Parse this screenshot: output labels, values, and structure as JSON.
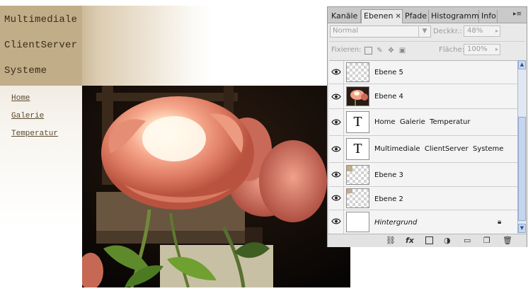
{
  "site": {
    "title_lines": [
      "Multimediale",
      "ClientServer",
      "Systeme"
    ],
    "nav": [
      "Home",
      "Galerie",
      "Temperatur"
    ]
  },
  "panel": {
    "tabs": [
      "Kanäle",
      "Ebenen",
      "Pfade",
      "Histogramm",
      "Info"
    ],
    "active_tab": "Ebenen",
    "blend_mode": "Normal",
    "opacity_label": "Deckkr.:",
    "opacity_value": "48%",
    "lock_label": "Fixieren:",
    "fill_label": "Fläche:",
    "fill_value": "100%",
    "layers": [
      {
        "name": "Ebene 5",
        "thumb": "transparent"
      },
      {
        "name": "Ebene 4",
        "thumb": "image"
      },
      {
        "name": "Home  Galerie  Temperatur",
        "thumb": "text"
      },
      {
        "name": "Multimediale  ClientServer  Systeme",
        "thumb": "text"
      },
      {
        "name": "Ebene 3",
        "thumb": "transparent"
      },
      {
        "name": "Ebene 2",
        "thumb": "transparent"
      },
      {
        "name": "Hintergrund",
        "thumb": "white",
        "locked": true
      }
    ],
    "text_thumb_glyph": "T",
    "bottom_icons": [
      "link-icon",
      "fx-icon",
      "mask-icon",
      "adjustment-icon",
      "group-folder-icon",
      "new-layer-icon",
      "trash-icon"
    ],
    "bottom_fx_label": "fx"
  }
}
